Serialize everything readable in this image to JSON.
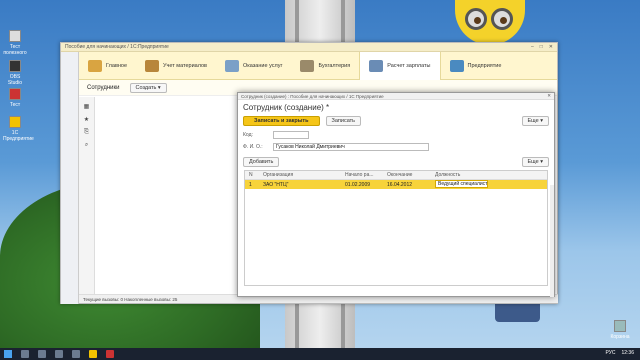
{
  "desktop": {
    "icons": [
      {
        "label": "Тест\nполезного"
      },
      {
        "label": "Пособие"
      },
      {
        "label": "OBS Studio"
      },
      {
        "label": "Тест"
      },
      {
        "label": "Корзина"
      },
      {
        "label": "1С Предприятие"
      }
    ],
    "right_icon": "Корзина"
  },
  "taskbar": {
    "lang": "РУС",
    "time": "12:36",
    "date": "07.03.2019"
  },
  "main": {
    "title": "Пособие для начинающих / 1С:Предприятие",
    "sections": [
      {
        "label": "Главное"
      },
      {
        "label": "Учет материалов"
      },
      {
        "label": "Оказание услуг"
      },
      {
        "label": "Бухгалтерия"
      },
      {
        "label": "Расчет зарплаты"
      },
      {
        "label": "Предприятие"
      }
    ],
    "toolbar": {
      "tab": "Сотрудники",
      "create": "Создать ▾"
    },
    "status": "Текущие вызовы: 0   Накопленные вызовы: 25"
  },
  "dialog": {
    "title": "Сотрудник (создание) : Пособие для начинающих / 1С Предприятие",
    "heading": "Сотрудник (создание) *",
    "save_close": "Записать и закрыть",
    "save": "Записать",
    "more": "Еще ▾",
    "code_label": "Код:",
    "code_value": "",
    "fio_label": "Ф. И. О.:",
    "fio_value": "Гусаков Николай Дмитриевич",
    "add": "Добавить",
    "more2": "Еще ▾",
    "columns": [
      "N",
      "Организация",
      "Начало ра...",
      "Окончание",
      "Должность"
    ],
    "rows": [
      {
        "n": "1",
        "org": "ЗАО \"НТЦ\"",
        "start": "01.02.2009",
        "end": "16.04.2012",
        "pos": "Ведущий специалист"
      }
    ]
  }
}
